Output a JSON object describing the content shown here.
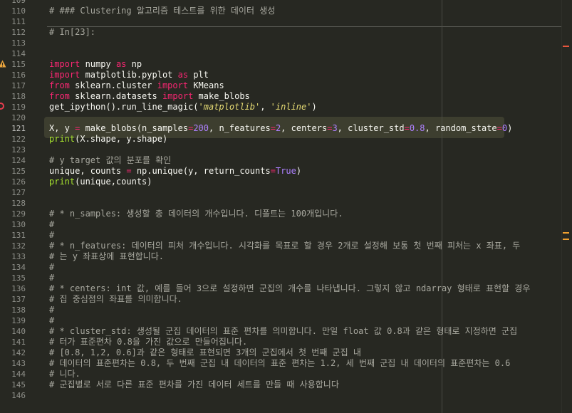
{
  "editor": {
    "lines": [
      {
        "num": "109",
        "segments": [
          {
            "t": "",
            "c": ""
          }
        ]
      },
      {
        "num": "110",
        "segments": [
          {
            "t": "# ### Clustering 알고리즘 테스트를 위한 데이터 생성",
            "c": "cm"
          }
        ]
      },
      {
        "num": "111",
        "segments": [
          {
            "t": "",
            "c": ""
          }
        ]
      },
      {
        "num": "112",
        "segments": [
          {
            "t": "# In[23]:",
            "c": "cm"
          }
        ]
      },
      {
        "num": "113",
        "segments": [
          {
            "t": "",
            "c": ""
          }
        ]
      },
      {
        "num": "114",
        "segments": [
          {
            "t": "",
            "c": ""
          }
        ]
      },
      {
        "num": "115",
        "segments": [
          {
            "t": "import",
            "c": "kw"
          },
          {
            "t": " numpy ",
            "c": ""
          },
          {
            "t": "as",
            "c": "kw"
          },
          {
            "t": " np",
            "c": ""
          }
        ]
      },
      {
        "num": "116",
        "segments": [
          {
            "t": "import",
            "c": "kw"
          },
          {
            "t": " matplotlib.pyplot ",
            "c": ""
          },
          {
            "t": "as",
            "c": "kw"
          },
          {
            "t": " plt",
            "c": ""
          }
        ]
      },
      {
        "num": "117",
        "segments": [
          {
            "t": "from",
            "c": "kw"
          },
          {
            "t": " sklearn.cluster ",
            "c": ""
          },
          {
            "t": "import",
            "c": "kw"
          },
          {
            "t": " KMeans",
            "c": ""
          }
        ]
      },
      {
        "num": "118",
        "segments": [
          {
            "t": "from",
            "c": "kw"
          },
          {
            "t": " sklearn.datasets ",
            "c": ""
          },
          {
            "t": "import",
            "c": "kw"
          },
          {
            "t": " make_blobs",
            "c": ""
          }
        ]
      },
      {
        "num": "119",
        "segments": [
          {
            "t": "get_ipython().run_line_magic(",
            "c": ""
          },
          {
            "t": "'matplotlib'",
            "c": "str"
          },
          {
            "t": ", ",
            "c": ""
          },
          {
            "t": "'inline'",
            "c": "str"
          },
          {
            "t": ")",
            "c": ""
          }
        ]
      },
      {
        "num": "120",
        "segments": [
          {
            "t": "",
            "c": ""
          }
        ]
      },
      {
        "num": "121",
        "segments": [
          {
            "t": "X, y ",
            "c": ""
          },
          {
            "t": "=",
            "c": "kw"
          },
          {
            "t": " make_blobs(n_samples",
            "c": ""
          },
          {
            "t": "=",
            "c": "kw"
          },
          {
            "t": "200",
            "c": "const"
          },
          {
            "t": ", n_features",
            "c": ""
          },
          {
            "t": "=",
            "c": "kw"
          },
          {
            "t": "2",
            "c": "const"
          },
          {
            "t": ", centers",
            "c": ""
          },
          {
            "t": "=",
            "c": "kw"
          },
          {
            "t": "3",
            "c": "const"
          },
          {
            "t": ", cluster_std",
            "c": ""
          },
          {
            "t": "=",
            "c": "kw"
          },
          {
            "t": "0.8",
            "c": "const"
          },
          {
            "t": ", random_state",
            "c": ""
          },
          {
            "t": "=",
            "c": "kw"
          },
          {
            "t": "0",
            "c": "const"
          },
          {
            "t": ")",
            "c": ""
          }
        ]
      },
      {
        "num": "122",
        "segments": [
          {
            "t": "print",
            "c": "fn"
          },
          {
            "t": "(X.shape, y.shape)",
            "c": ""
          }
        ]
      },
      {
        "num": "123",
        "segments": [
          {
            "t": "",
            "c": ""
          }
        ]
      },
      {
        "num": "124",
        "segments": [
          {
            "t": "# y target 값의 분포를 확인",
            "c": "cm"
          }
        ]
      },
      {
        "num": "125",
        "segments": [
          {
            "t": "unique, counts ",
            "c": ""
          },
          {
            "t": "=",
            "c": "kw"
          },
          {
            "t": " np.unique(y, return_counts",
            "c": ""
          },
          {
            "t": "=",
            "c": "kw"
          },
          {
            "t": "True",
            "c": "const"
          },
          {
            "t": ")",
            "c": ""
          }
        ]
      },
      {
        "num": "126",
        "segments": [
          {
            "t": "print",
            "c": "fn"
          },
          {
            "t": "(unique,counts)",
            "c": ""
          }
        ]
      },
      {
        "num": "127",
        "segments": [
          {
            "t": "",
            "c": ""
          }
        ]
      },
      {
        "num": "128",
        "segments": [
          {
            "t": "",
            "c": ""
          }
        ]
      },
      {
        "num": "129",
        "segments": [
          {
            "t": "# * n_samples: 생성할 총 데이터의 개수입니다. 디폴트는 100개입니다.",
            "c": "cm"
          }
        ]
      },
      {
        "num": "130",
        "segments": [
          {
            "t": "#",
            "c": "cm"
          }
        ]
      },
      {
        "num": "131",
        "segments": [
          {
            "t": "#",
            "c": "cm"
          }
        ]
      },
      {
        "num": "132",
        "segments": [
          {
            "t": "# * n_features: 데이터의 피처 개수입니다. 시각화를 목표로 할 경우 2개로 설정해 보통 첫 번째 피처는 x 좌표, 두",
            "c": "cm"
          }
        ]
      },
      {
        "num": "133",
        "segments": [
          {
            "t": "# 는 y 좌표상에 표현합니다.",
            "c": "cm"
          }
        ]
      },
      {
        "num": "134",
        "segments": [
          {
            "t": "#",
            "c": "cm"
          }
        ]
      },
      {
        "num": "135",
        "segments": [
          {
            "t": "#",
            "c": "cm"
          }
        ]
      },
      {
        "num": "136",
        "segments": [
          {
            "t": "# * centers: int 값, 예를 들어 3으로 설정하면 군집의 개수를 나타냅니다. 그렇지 않고 ndarray 형태로 표현할 경우",
            "c": "cm"
          }
        ]
      },
      {
        "num": "137",
        "segments": [
          {
            "t": "# 집 중심점의 좌표를 의미합니다.",
            "c": "cm"
          }
        ]
      },
      {
        "num": "138",
        "segments": [
          {
            "t": "#",
            "c": "cm"
          }
        ]
      },
      {
        "num": "139",
        "segments": [
          {
            "t": "#",
            "c": "cm"
          }
        ]
      },
      {
        "num": "140",
        "segments": [
          {
            "t": "# * cluster_std: 생성될 군집 데이터의 표준 편차를 의미합니다. 만일 float 값 0.8과 같은 형태로 지정하면 군집",
            "c": "cm"
          }
        ]
      },
      {
        "num": "141",
        "segments": [
          {
            "t": "# 터가 표준편차 0.8을 가진 값으로 만들어집니다.",
            "c": "cm"
          }
        ]
      },
      {
        "num": "142",
        "segments": [
          {
            "t": "# [0.8, 1,2, 0.6]과 같은 형태로 표현되면 3개의 군집에서 첫 번째 군집 내",
            "c": "cm"
          }
        ]
      },
      {
        "num": "143",
        "segments": [
          {
            "t": "# 데이터의 표준편차는 0.8, 두 번째 군집 내 데이터의 표준 편차는 1.2, 세 번째 군집 내 데이터의 표준편차는 0.6",
            "c": "cm"
          }
        ]
      },
      {
        "num": "144",
        "segments": [
          {
            "t": "# 니다.",
            "c": "cm"
          }
        ]
      },
      {
        "num": "145",
        "segments": [
          {
            "t": "# 군집별로 서로 다른 표준 편차를 가진 데이터 세트를 만들 때 사용합니다",
            "c": "cm"
          }
        ]
      },
      {
        "num": "146",
        "segments": [
          {
            "t": "",
            "c": ""
          }
        ]
      }
    ]
  },
  "colors": {
    "background": "#272822",
    "comment": "#a8a89f",
    "keyword": "#f92672",
    "function": "#a6e22e",
    "string": "#e6db74",
    "constant": "#ae81ff",
    "warning": "#e8a33d",
    "error": "#e83d4f",
    "minimap_red": "#e8563d",
    "minimap_orange": "#f0a030"
  },
  "icons": {
    "warning": "warning-triangle-icon",
    "error": "error-circle-icon"
  }
}
